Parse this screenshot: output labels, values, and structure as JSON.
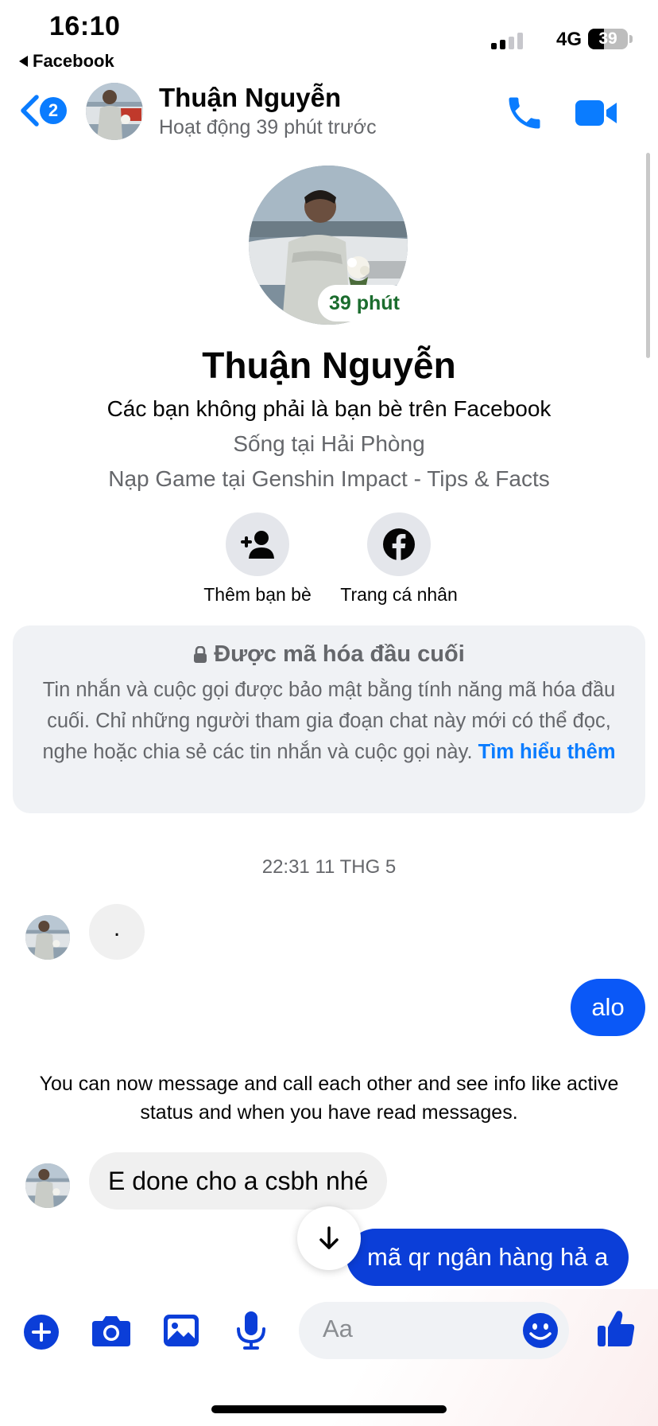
{
  "status_bar": {
    "time": "16:10",
    "back_app": "Facebook",
    "network": "4G",
    "battery_level": 39,
    "battery_label": "39"
  },
  "header": {
    "unread_count": "2",
    "name": "Thuận Nguyễn",
    "status": "Hoạt động 39 phút trước",
    "icons": [
      "back-chevron-icon",
      "phone-icon",
      "video-camera-icon"
    ],
    "accent_color": "#0a7cff"
  },
  "profile": {
    "active_badge": "39 phút",
    "name": "Thuận Nguyễn",
    "friendship_note": "Các bạn không phải là bạn bè trên Facebook",
    "location": "Sống tại Hải Phòng",
    "work": "Nạp Game tại Genshin Impact - Tips & Facts",
    "actions": [
      {
        "label": "Thêm bạn bè",
        "icon": "add-person-icon"
      },
      {
        "label": "Trang cá nhân",
        "icon": "facebook-icon"
      }
    ]
  },
  "e2ee": {
    "title": "Được mã hóa đầu cuối",
    "body": "Tin nhắn và cuộc gọi được bảo mật bằng tính năng mã hóa đầu cuối. Chỉ những người tham gia đoạn chat này mới có thể đọc, nghe hoặc chia sẻ các tin nhắn và cuộc gọi này.",
    "link": "Tìm hiểu thêm"
  },
  "chat": {
    "timestamp": "22:31 11 THG 5",
    "messages": [
      {
        "from": "them",
        "text": "."
      },
      {
        "from": "me",
        "text": "alo"
      },
      {
        "from": "system",
        "text": "You can now message and call each other and see info like active status and when you have read messages."
      },
      {
        "from": "them",
        "text": "E done cho a csbh nhé"
      },
      {
        "from": "me",
        "text": "mã qr ngân hàng hả a"
      }
    ],
    "outgoing_color": "#0a58f7"
  },
  "composer": {
    "placeholder": "Aa",
    "icons": [
      "plus-icon",
      "camera-icon",
      "gallery-icon",
      "microphone-icon",
      "emoji-icon",
      "thumbs-up-icon"
    ]
  }
}
